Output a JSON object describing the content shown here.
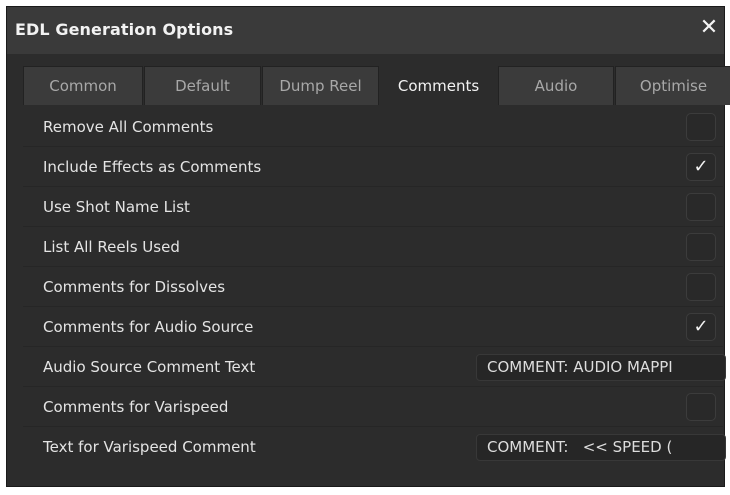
{
  "window": {
    "title": "EDL Generation Options",
    "close_glyph": "✕"
  },
  "tabs": [
    {
      "label": "Common",
      "active": false
    },
    {
      "label": "Default",
      "active": false
    },
    {
      "label": "Dump Reel",
      "active": false
    },
    {
      "label": "Comments",
      "active": true
    },
    {
      "label": "Audio",
      "active": false
    },
    {
      "label": "Optimise",
      "active": false
    }
  ],
  "options": [
    {
      "label": "Remove All Comments",
      "type": "checkbox",
      "checked": false
    },
    {
      "label": "Include Effects as Comments",
      "type": "checkbox",
      "checked": true
    },
    {
      "label": "Use Shot Name List",
      "type": "checkbox",
      "checked": false
    },
    {
      "label": "List All Reels Used",
      "type": "checkbox",
      "checked": false
    },
    {
      "label": "Comments for Dissolves",
      "type": "checkbox",
      "checked": false
    },
    {
      "label": "Comments for Audio Source",
      "type": "checkbox",
      "checked": true
    },
    {
      "label": "Audio Source Comment Text",
      "type": "text",
      "value": "COMMENT: AUDIO MAPPI"
    },
    {
      "label": "Comments for Varispeed",
      "type": "checkbox",
      "checked": false
    },
    {
      "label": "Text for Varispeed Comment",
      "type": "text",
      "value": "COMMENT:   << SPEED ("
    }
  ],
  "colors": {
    "background": "#2c2c2c",
    "titlebar": "#3a3a3a",
    "text": "#e4e4e4",
    "inactive_tab_text": "#a8a8a8"
  },
  "check_glyph": "✓"
}
